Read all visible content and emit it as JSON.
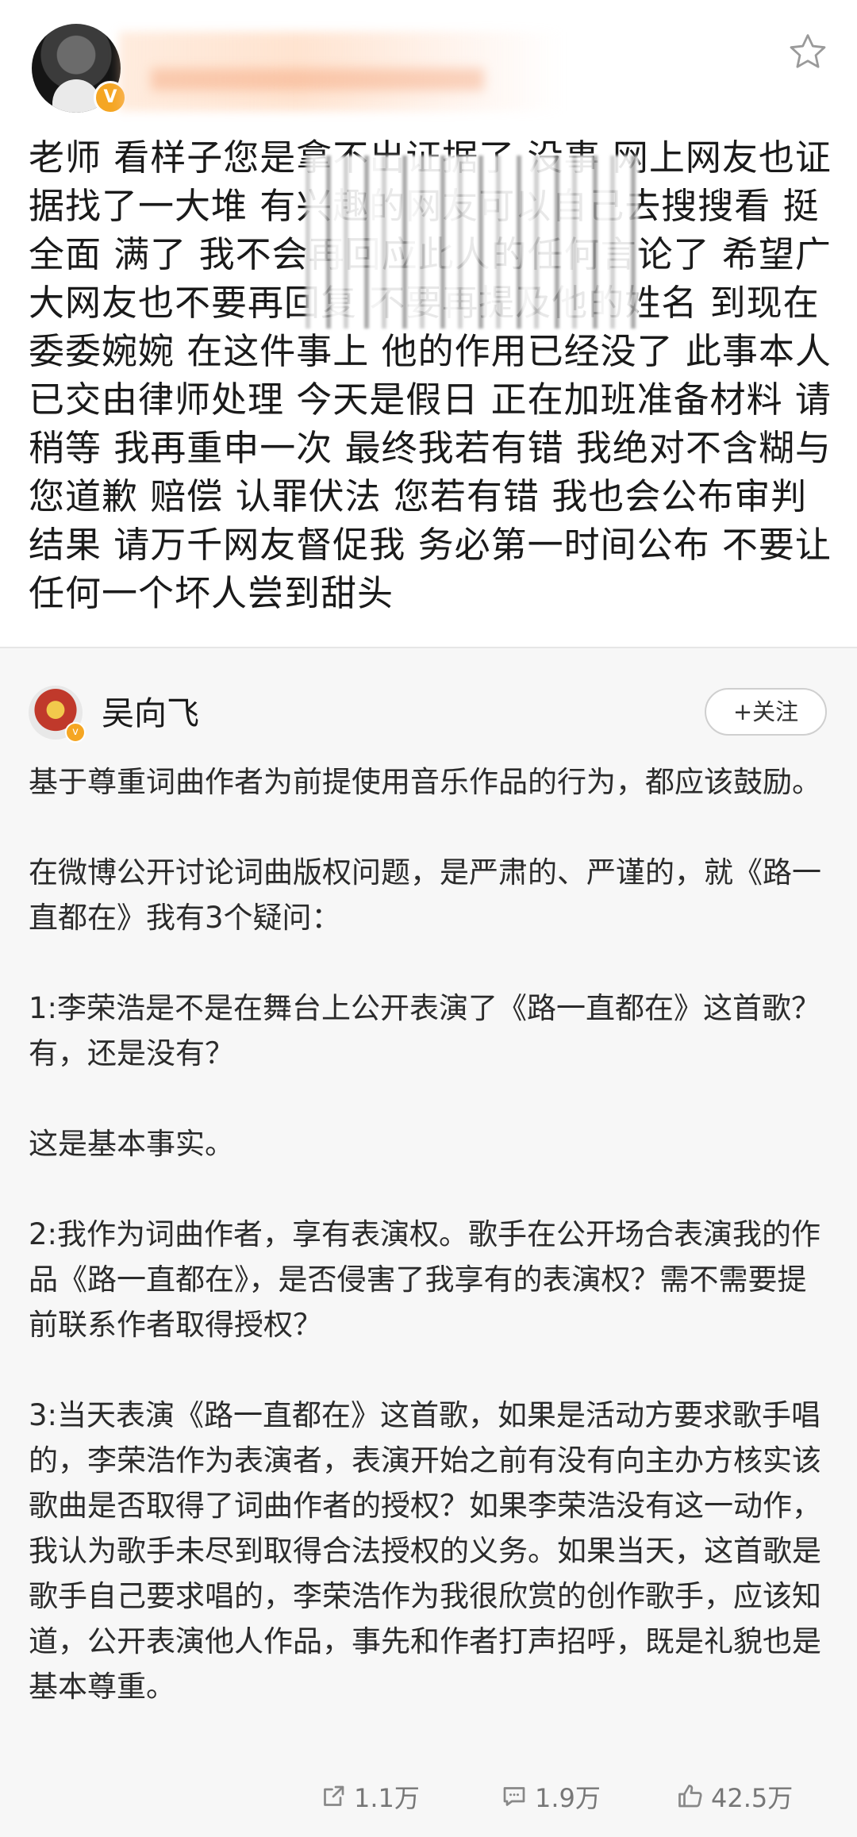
{
  "post": {
    "text": "老师 看样子您是拿不出证据了 没事 网上网友也证据找了一大堆 有兴趣的网友可以自己去搜搜看 挺全面 满了 我不会再回应此人的任何言论了 希望广大网友也不要再回复 不要再提及他的姓名 到现在委委婉婉 在这件事上 他的作用已经没了 此事本人已交由律师处理 今天是假日 正在加班准备材料 请稍等  我再重申一次 最终我若有错 我绝对不含糊与您道歉 赔偿 认罪伏法 您若有错 我也会公布审判结果 请万千网友督促我 务必第一时间公布 不要让任何一个坏人尝到甜头"
  },
  "repost": {
    "author": "吴向飞",
    "follow_label": "+关注",
    "paragraphs": [
      "基于尊重词曲作者为前提使用音乐作品的行为，都应该鼓励。",
      "在微博公开讨论词曲版权问题，是严肃的、严谨的，就《路一直都在》我有3个疑问：",
      "1:李荣浩是不是在舞台上公开表演了《路一直都在》这首歌？有，还是没有？",
      "这是基本事实。",
      "2:我作为词曲作者，享有表演权。歌手在公开场合表演我的作品《路一直都在》，是否侵害了我享有的表演权？需不需要提前联系作者取得授权？",
      "3:当天表演《路一直都在》这首歌，如果是活动方要求歌手唱的，李荣浩作为表演者，表演开始之前有没有向主办方核实该歌曲是否取得了词曲作者的授权？如果李荣浩没有这一动作，我认为歌手未尽到取得合法授权的义务。如果当天，这首歌是歌手自己要求唱的，李荣浩作为我很欣赏的创作歌手，应该知道，公开表演他人作品，事先和作者打声招呼，既是礼貌也是基本尊重。"
    ]
  },
  "actions": {
    "repost_count": "1.1万",
    "comment_count": "1.9万",
    "like_count": "42.5万"
  },
  "icons": {
    "favorite": "star-icon",
    "repost": "share-icon",
    "comment": "comment-icon",
    "like": "thumbs-up-icon"
  },
  "colors": {
    "verified_badge": "#f5a623",
    "repost_background": "#f7f7f7",
    "action_text": "#777777"
  }
}
